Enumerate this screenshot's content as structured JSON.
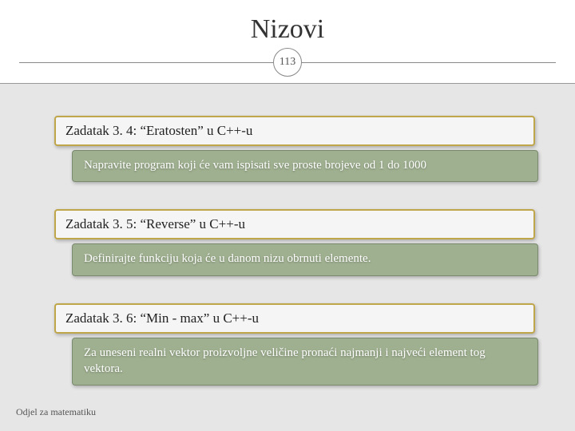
{
  "title": "Nizovi",
  "page_number": "113",
  "tasks": [
    {
      "heading": "Zadatak 3. 4: “Eratosten” u C++-u",
      "body": "Napravite program koji će vam ispisati sve proste brojeve od 1 do 1000"
    },
    {
      "heading": "Zadatak 3. 5: “Reverse” u C++-u",
      "body": "Definirajte funkciju koja će u danom nizu obrnuti elemente."
    },
    {
      "heading": "Zadatak 3. 6: “Min - max” u C++-u",
      "body": "Za uneseni realni vektor proizvoljne veličine pronaći najmanji i najveći element tog vektora."
    }
  ],
  "footer": "Odjel za matematiku"
}
